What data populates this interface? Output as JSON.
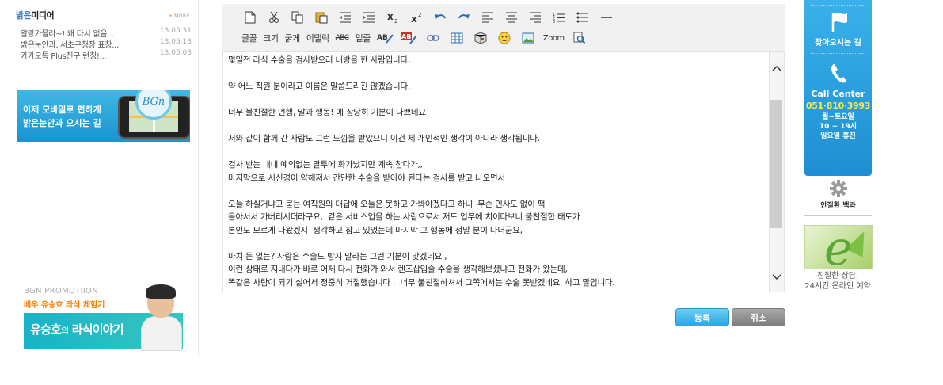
{
  "left": {
    "media": {
      "title_prefix": "밝은",
      "title_suffix": "미디어",
      "more_label": "MORE",
      "items": [
        {
          "title": "알랑가몰라~! 왜 다시 없음...",
          "date": "13.05.31"
        },
        {
          "title": "밝은눈안과, 서초구청장 표창...",
          "date": "13.05.13"
        },
        {
          "title": "카카오톡 Plus친구 런칭!...",
          "date": "13.05.03"
        }
      ]
    },
    "mobile_banner": {
      "line1": "이제 모바일로 편하게",
      "line2": "밝은눈안과 오시는 길",
      "badge": "BGn"
    },
    "promotion": {
      "kicker": "BGN PROMOTIION",
      "subtitle": "배우 유승호 라식 체험기",
      "banner_main": "유승호",
      "banner_small": "의",
      "banner_rest": "라식이야기"
    }
  },
  "editor": {
    "toolbar_row2": {
      "font": "글꼴",
      "size": "크기",
      "bold": "굵게",
      "italic": "이탤릭",
      "strike": "ABC",
      "underline": "밑줄",
      "zoom": "Zoom"
    },
    "content": "몇일전 라식 수술을 검사받으러 내방을 한 사람입니다,\n\n약 어느 직원 분이라고 이름은 말씀드리진 않겠습니다.\n\n너무 불친절한 언행, 말과 행동! 에 상당히 기분이 나쁘네요\n\n저와 같이 함께 간 사람도 그런 느낌을 받았으니 이건 제 개인적인 생각이 아니라 생각됩니다.\n\n검사 받는 내내 예의없는 말투에 화가났지만 계속 참다가,,\n마지막으로 시신경이 약해져서 간단한 수술을 받아야 된다는 검사를 받고 나오면서\n\n오늘 하실거냐고 묻는 여직원의 대답에 오늘은 못하고 가봐야겠다고 하니  무슨 인사도 없이 팩\n돌아서서 가버리시더라구요,  같은 서비스업을 하는 사람으로서 저도 업무에 치이다보니 불친절한 태도가\n본인도 모르게 나왔겠지  생각하고 참고 있었는데 마지막 그 행동에 정말 분이 나더군요,\n\n마치 돈 없는? 사람은 수술도 받지 말라는 그런 기분이 맞겠네요 ,\n이런 상태로 지내다가 바로 어제 다시 전화가 와서 렌즈삽입술 수술을 생각해보셨냐고 전화가 왔는데,\n똑같은 사람이 되기 싫어서 정중히 거절했습니다 .  너무 불친절하셔서 그쪽에서는 수술 못받겠네요  하고 말입니다.",
    "submit_label": "등록",
    "cancel_label": "취소"
  },
  "right": {
    "directions_label": "찾아오시는 길",
    "call_center_label": "Call Center",
    "phone": "051·810·3993",
    "hours_line1": "월~토요일",
    "hours_line2": "10 ~ 19시",
    "hours_line3": "일요일 휴진",
    "eye_disease_label": "안질환 백과",
    "consult_line1": "친절한 상담,",
    "consult_line2": "24시간 온라인 예약"
  },
  "colors": {
    "accent_blue": "#1e8fd3",
    "phone_yellow": "#ffea3b",
    "more_orange": "#ff7a00"
  }
}
